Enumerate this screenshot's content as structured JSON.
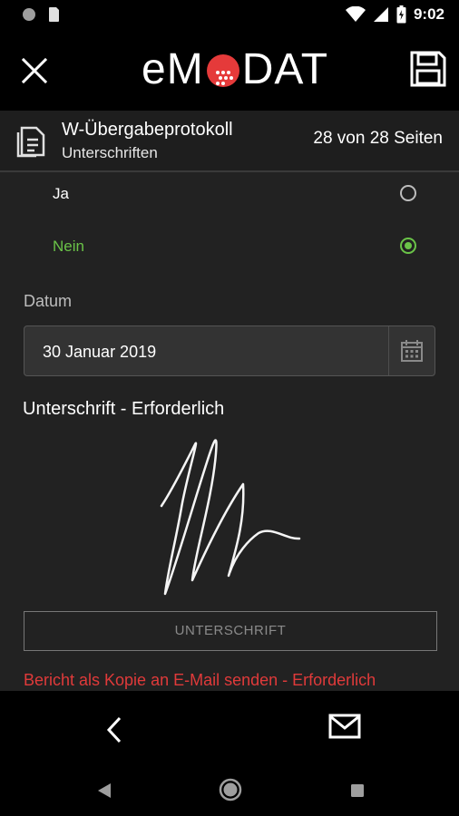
{
  "status_bar": {
    "time": "9:02",
    "icons": [
      "circle-icon",
      "sim-card-icon",
      "wifi-icon",
      "cellular-signal-icon",
      "battery-charging-icon"
    ]
  },
  "app_bar": {
    "logo_left": "eM",
    "logo_right": "DAT",
    "icons": [
      "close-icon",
      "save-icon"
    ]
  },
  "document_header": {
    "title": "W-Übergabeprotokoll",
    "subtitle": "Unterschriften",
    "pages": "28 von 28 Seiten",
    "icon": "documents-icon"
  },
  "form": {
    "options": [
      {
        "label": "Ja",
        "selected": false
      },
      {
        "label": "Nein",
        "selected": true
      }
    ],
    "date_label": "Datum",
    "date_value": "30 Januar 2019",
    "signature_heading": "Unterschrift - Erforderlich",
    "signature_button": "UNTERSCHRIFT",
    "email_required": "Bericht als Kopie an E-Mail senden - Erforderlich"
  },
  "colors": {
    "selected": "#6ac348",
    "error": "#e03a3a",
    "logo_accent": "#e53a3a"
  },
  "bottom_bar": {
    "icons": [
      "chevron-left-icon",
      "mail-icon"
    ]
  },
  "system_nav": {
    "icons": [
      "nav-back-icon",
      "nav-home-icon",
      "nav-recents-icon"
    ]
  }
}
